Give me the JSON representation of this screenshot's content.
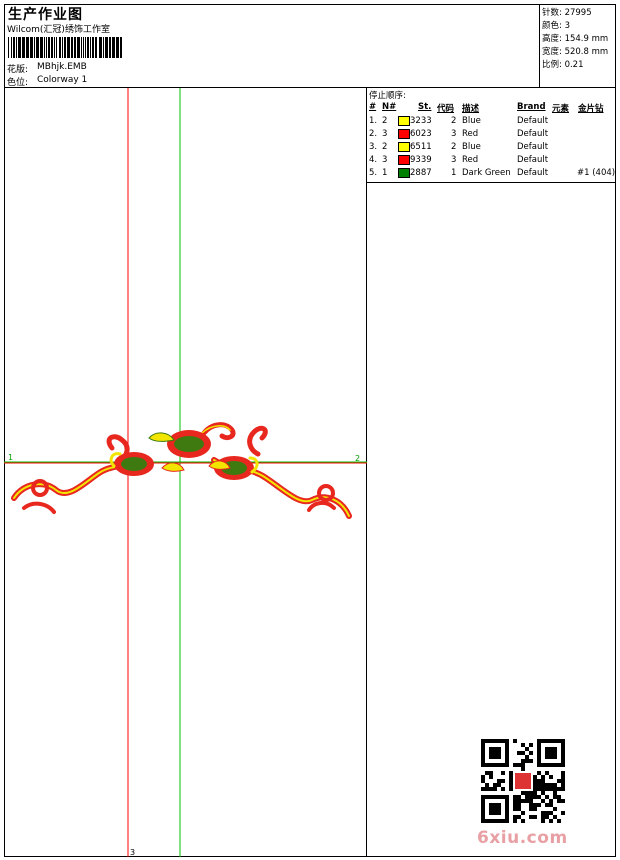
{
  "header": {
    "title": "生产作业图",
    "company": "Wilcom(汇冠)绣饰工作室",
    "design_label": "花版:",
    "design_value": "MBhjk.EMB",
    "colorway_label": "色位:",
    "colorway_value": "Colorway 1"
  },
  "stats": {
    "stitches": "针数: 27995",
    "colors": "颜色: 3",
    "height": "高度: 154.9 mm",
    "width": "宽度: 520.8 mm",
    "scale": "比例: 0.21"
  },
  "canvas": {
    "left_marker": "1",
    "right_marker": "2",
    "bottom_marker": "3"
  },
  "table": {
    "title": "停止顺序:",
    "headers": [
      "#",
      "N#",
      "St.",
      "代码",
      "描述",
      "Brand",
      "元素",
      "金片钻"
    ],
    "rows": [
      {
        "idx": "1.",
        "n": "2",
        "color": "#ffff00",
        "code": "3233",
        "st": "2",
        "desc": "Blue",
        "brand": "Default",
        "extra": ""
      },
      {
        "idx": "2.",
        "n": "3",
        "color": "#ff0000",
        "code": "6023",
        "st": "3",
        "desc": "Red",
        "brand": "Default",
        "extra": ""
      },
      {
        "idx": "3.",
        "n": "2",
        "color": "#ffff00",
        "code": "6511",
        "st": "2",
        "desc": "Blue",
        "brand": "Default",
        "extra": ""
      },
      {
        "idx": "4.",
        "n": "3",
        "color": "#ff0000",
        "code": "9339",
        "st": "3",
        "desc": "Red",
        "brand": "Default",
        "extra": ""
      },
      {
        "idx": "5.",
        "n": "1",
        "color": "#008000",
        "code": "2887",
        "st": "1",
        "desc": "Dark Green",
        "brand": "Default",
        "extra": "#1 (404)"
      }
    ]
  },
  "watermark": "6xiu.com",
  "colors": {
    "red_guide": "#ff0000",
    "green_guide": "#00c000",
    "emb_red": "#e8281e",
    "emb_yellow": "#f2e600",
    "emb_green": "#3f7a10"
  }
}
